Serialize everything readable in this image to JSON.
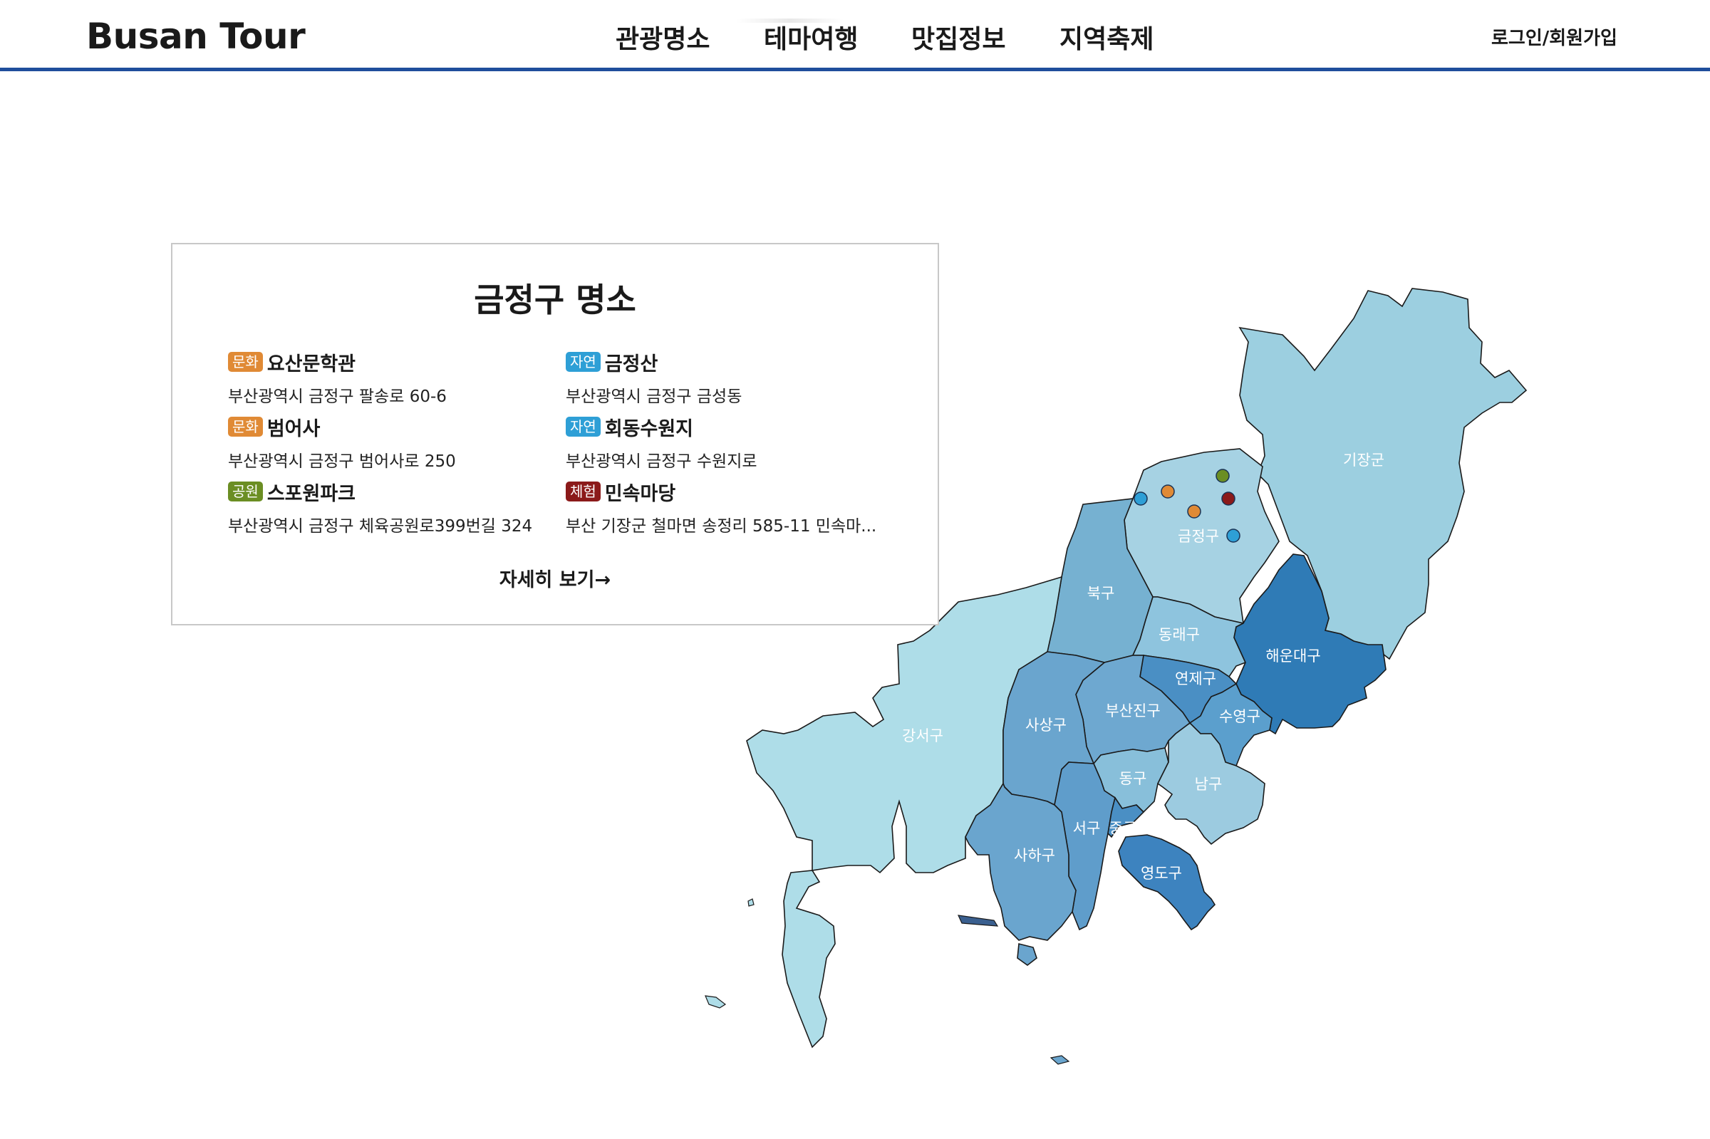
{
  "header": {
    "logo": "Busan Tour",
    "nav": [
      "관광명소",
      "테마여행",
      "맛집정보",
      "지역축제"
    ],
    "login": "로그인/회원가입"
  },
  "map": {
    "districts": [
      {
        "name": "기장군",
        "color": "#9ccfe0"
      },
      {
        "name": "금정구",
        "color": "#a6d2e3"
      },
      {
        "name": "북구",
        "color": "#76b1d1"
      },
      {
        "name": "강서구",
        "color": "#aedde8"
      },
      {
        "name": "동래구",
        "color": "#8ec4de"
      },
      {
        "name": "해운대구",
        "color": "#2f7bb6"
      },
      {
        "name": "연제구",
        "color": "#4a8fc4"
      },
      {
        "name": "수영구",
        "color": "#5b9fcd"
      },
      {
        "name": "부산진구",
        "color": "#6ea8d0"
      },
      {
        "name": "사상구",
        "color": "#6aa5ce"
      },
      {
        "name": "동구",
        "color": "#88bfda"
      },
      {
        "name": "남구",
        "color": "#9ccbe0"
      },
      {
        "name": "서구",
        "color": "#5f9dcb"
      },
      {
        "name": "중구",
        "color": "#4a8fc4"
      },
      {
        "name": "사하구",
        "color": "#6aa5ce"
      },
      {
        "name": "영도구",
        "color": "#3d83bf"
      }
    ],
    "markers": [
      {
        "category": "자연",
        "color": "#2e9fd6"
      },
      {
        "category": "문화",
        "color": "#e08a35"
      },
      {
        "category": "공원",
        "color": "#6b8e23"
      },
      {
        "category": "문화",
        "color": "#e08a35"
      },
      {
        "category": "체험",
        "color": "#8b1a1a"
      },
      {
        "category": "자연",
        "color": "#2e9fd6"
      }
    ]
  },
  "info": {
    "title": "금정구 명소",
    "places": [
      {
        "category": "문화",
        "color": "#e08a35",
        "name": "요산문학관",
        "address": "부산광역시 금정구 팔송로 60-6"
      },
      {
        "category": "자연",
        "color": "#2e9fd6",
        "name": "금정산",
        "address": "부산광역시 금정구 금성동"
      },
      {
        "category": "문화",
        "color": "#e08a35",
        "name": "범어사",
        "address": "부산광역시 금정구 범어사로 250"
      },
      {
        "category": "자연",
        "color": "#2e9fd6",
        "name": "회동수원지",
        "address": "부산광역시 금정구 수원지로"
      },
      {
        "category": "공원",
        "color": "#6b8e23",
        "name": "스포원파크",
        "address": "부산광역시 금정구 체육공원로399번길 324"
      },
      {
        "category": "체험",
        "color": "#8b1a1a",
        "name": "민속마당",
        "address": "부산 기장군 철마면 송정리 585-11 민속마..."
      }
    ],
    "more": "자세히 보기→"
  }
}
